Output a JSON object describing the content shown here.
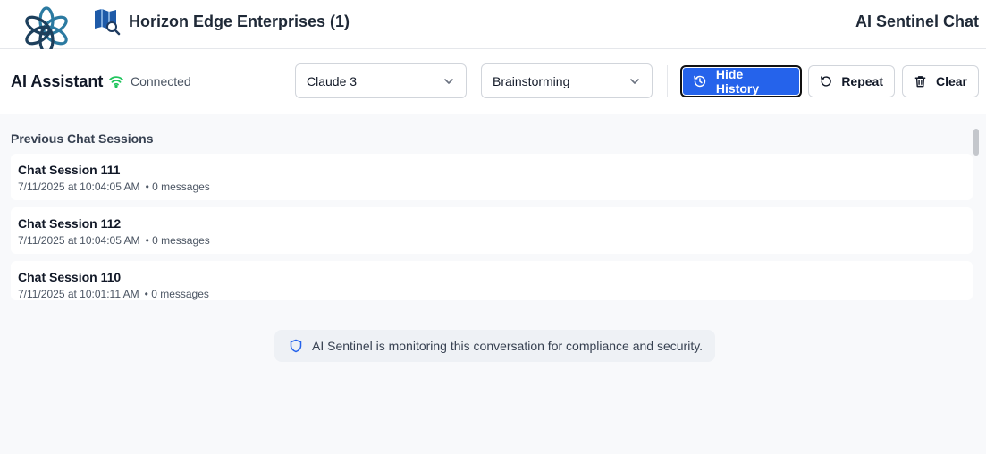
{
  "header": {
    "org_name": "Horizon Edge Enterprises (1)",
    "app_title": "AI Sentinel Chat"
  },
  "toolbar": {
    "assistant_title": "AI Assistant",
    "status": "Connected",
    "model_select": {
      "value": "Claude 3"
    },
    "mode_select": {
      "value": "Brainstorming"
    },
    "hide_history_label": "Hide History",
    "repeat_label": "Repeat",
    "clear_label": "Clear"
  },
  "history": {
    "heading": "Previous Chat Sessions",
    "sessions": [
      {
        "title": "Chat Session 111",
        "timestamp": "7/11/2025 at 10:04:05 AM",
        "messages": "• 0 messages"
      },
      {
        "title": "Chat Session 112",
        "timestamp": "7/11/2025 at 10:04:05 AM",
        "messages": "• 0 messages"
      },
      {
        "title": "Chat Session 110",
        "timestamp": "7/11/2025 at 10:01:11 AM",
        "messages": "• 0 messages"
      }
    ]
  },
  "notice": {
    "text": "AI Sentinel is monitoring this conversation for compliance and security."
  },
  "colors": {
    "primary": "#2563eb",
    "connected": "#22c55e",
    "shield": "#2563eb"
  }
}
